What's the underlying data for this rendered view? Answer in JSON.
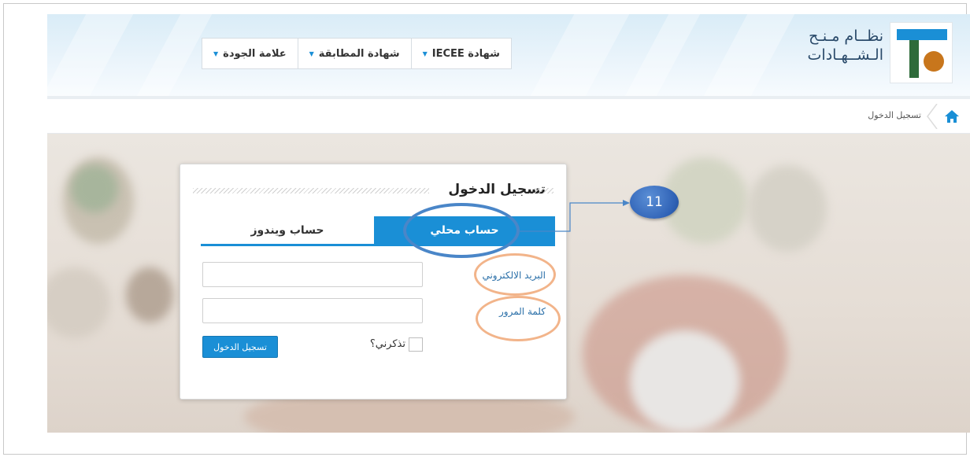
{
  "header": {
    "logo_line1": "نظــام مـنـح",
    "logo_line2": "الـشــهـادات",
    "nav": [
      {
        "label": "علامة الجودة"
      },
      {
        "label": "شهادة المطابقة"
      },
      {
        "label": "شهادة IECEE"
      }
    ]
  },
  "breadcrumb": {
    "current": "تسجيل الدخول"
  },
  "login": {
    "title": "تسجيل الدخول",
    "tabs": {
      "local": "حساب محلي",
      "windows": "حساب ويندوز"
    },
    "email_label": "البريد الالكتروني",
    "password_label": "كلمة المرور",
    "email_value": "",
    "password_value": "",
    "remember_label": "تذكرني؟",
    "submit_label": "تسجيل الدخول"
  },
  "annotation": {
    "step_number": "11"
  },
  "colors": {
    "accent": "#1a8fd6",
    "annotation_blue": "#4a86c8",
    "annotation_orange": "#f2b48a"
  }
}
